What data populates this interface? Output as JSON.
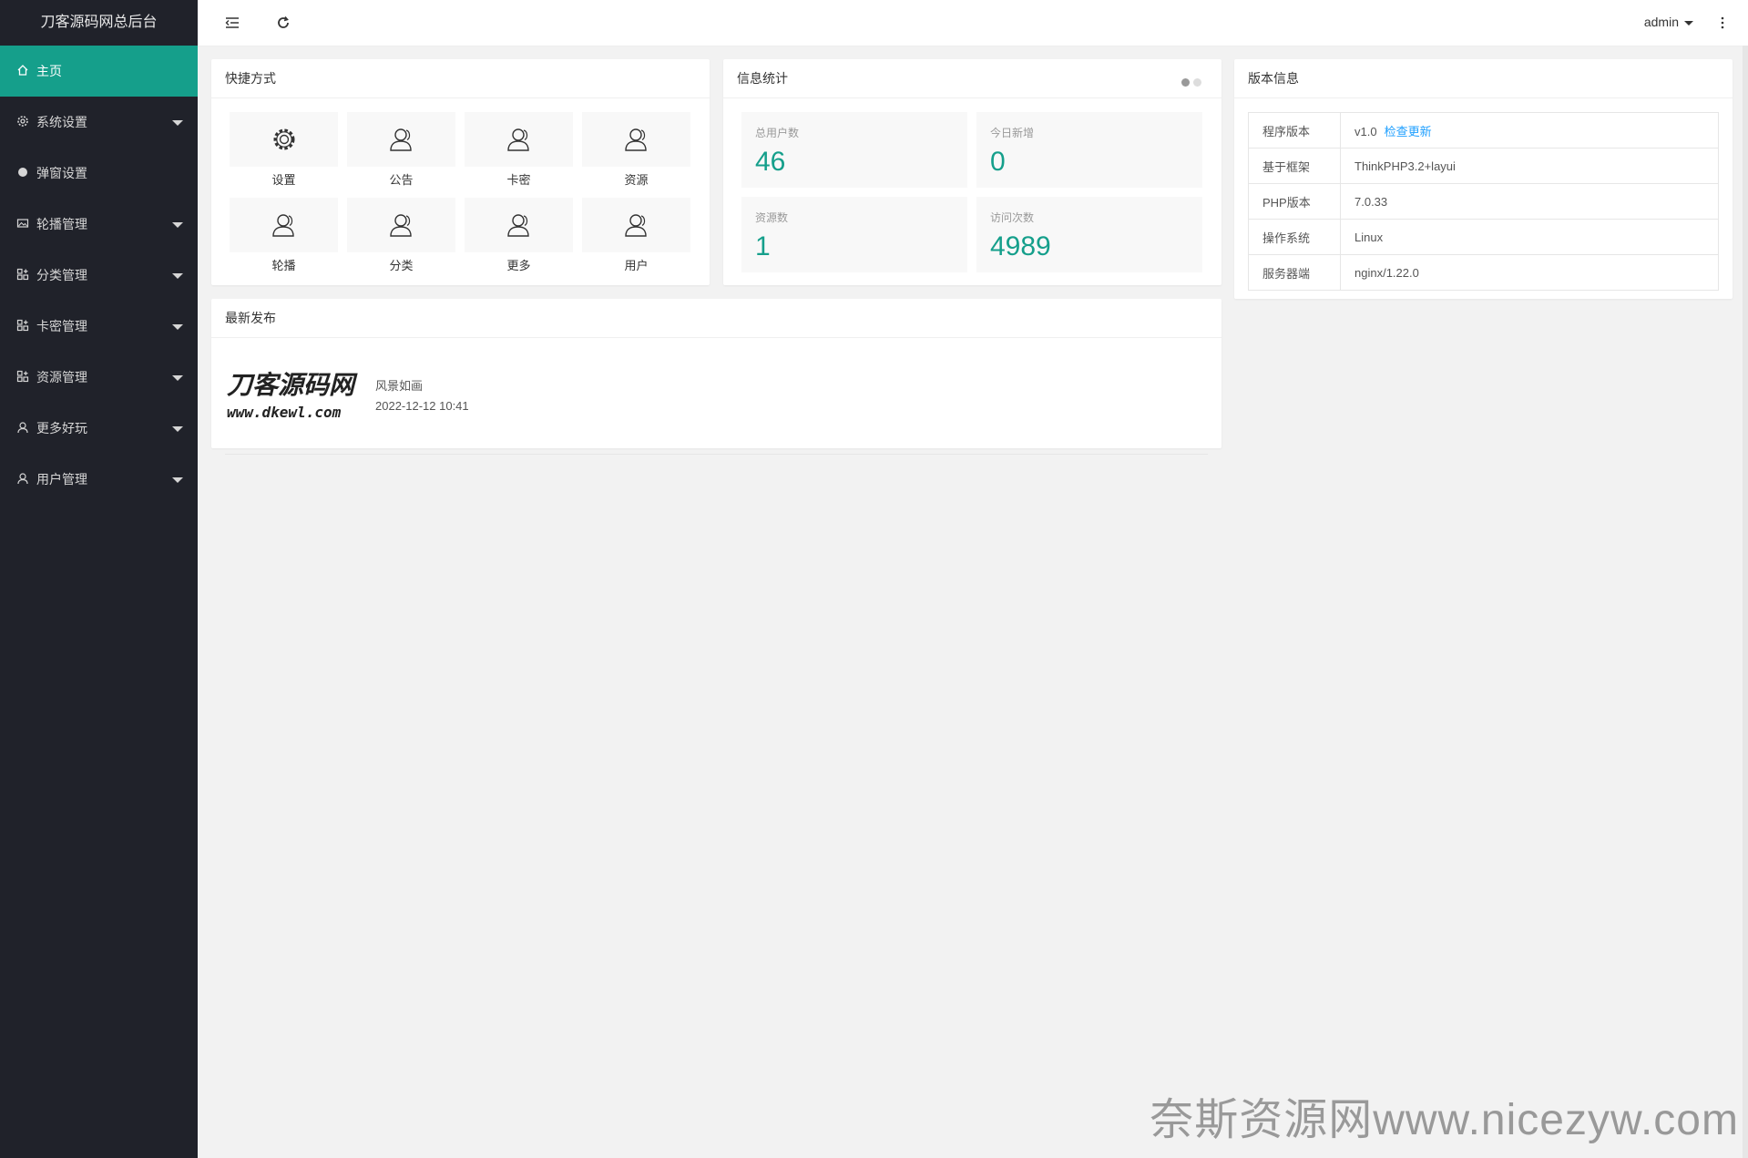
{
  "app": {
    "title": "刀客源码网总后台"
  },
  "sidebar": {
    "items": [
      {
        "label": "主页",
        "icon": "home-icon",
        "active": true,
        "expandable": false
      },
      {
        "label": "系统设置",
        "icon": "gear-icon",
        "expandable": true
      },
      {
        "label": "弹窗设置",
        "icon": "circle-icon",
        "expandable": false
      },
      {
        "label": "轮播管理",
        "icon": "image-icon",
        "expandable": true
      },
      {
        "label": "分类管理",
        "icon": "apps-icon",
        "expandable": true
      },
      {
        "label": "卡密管理",
        "icon": "apps-icon",
        "expandable": true
      },
      {
        "label": "资源管理",
        "icon": "apps-icon",
        "expandable": true
      },
      {
        "label": "更多好玩",
        "icon": "user-icon",
        "expandable": true
      },
      {
        "label": "用户管理",
        "icon": "user-icon",
        "expandable": true
      }
    ]
  },
  "header": {
    "user": "admin"
  },
  "quick": {
    "title": "快捷方式",
    "items": [
      {
        "label": "设置",
        "icon": "gear-icon"
      },
      {
        "label": "公告",
        "icon": "user-icon"
      },
      {
        "label": "卡密",
        "icon": "user-icon"
      },
      {
        "label": "资源",
        "icon": "user-icon"
      },
      {
        "label": "轮播",
        "icon": "user-icon"
      },
      {
        "label": "分类",
        "icon": "user-icon"
      },
      {
        "label": "更多",
        "icon": "user-icon"
      },
      {
        "label": "用户",
        "icon": "user-icon"
      }
    ]
  },
  "stats": {
    "title": "信息统计",
    "items": [
      {
        "name": "总用户数",
        "value": "46"
      },
      {
        "name": "今日新增",
        "value": "0"
      },
      {
        "name": "资源数",
        "value": "1"
      },
      {
        "name": "访问次数",
        "value": "4989"
      }
    ]
  },
  "version": {
    "title": "版本信息",
    "rows": [
      {
        "key": "程序版本",
        "value": "v1.0",
        "link": "检查更新"
      },
      {
        "key": "基于框架",
        "value": "ThinkPHP3.2+layui"
      },
      {
        "key": "PHP版本",
        "value": "7.0.33"
      },
      {
        "key": "操作系统",
        "value": "Linux"
      },
      {
        "key": "服务器端",
        "value": "nginx/1.22.0"
      }
    ]
  },
  "latest": {
    "title": "最新发布",
    "posts": [
      {
        "logo_text": "刀客源码网",
        "logo_url": "www.dkewl.com",
        "title": "风景如画",
        "date": "2022-12-12 10:41"
      }
    ]
  },
  "watermark": "奈斯资源网www.nicezyw.com",
  "colors": {
    "accent": "#159f8b",
    "sidebar": "#20222a",
    "link": "#1e9fff"
  }
}
